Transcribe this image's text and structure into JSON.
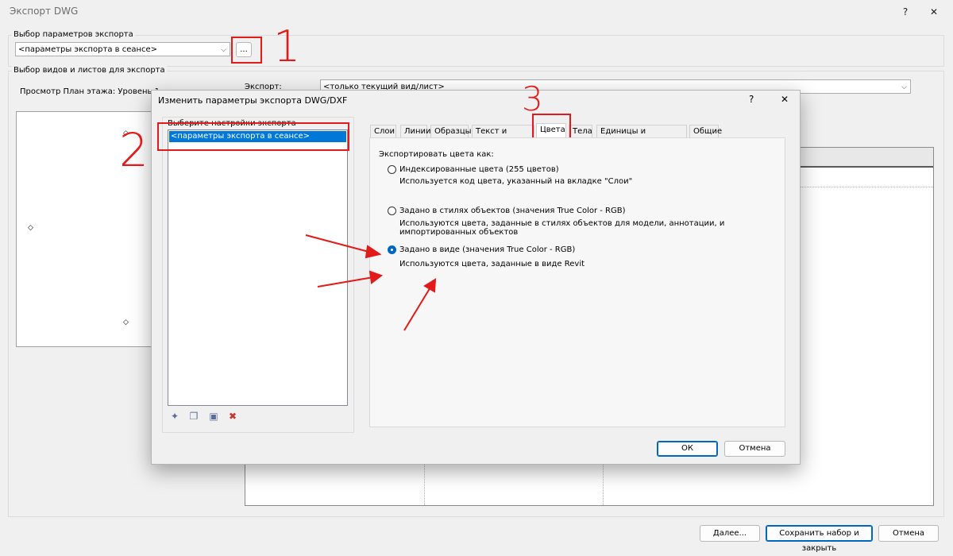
{
  "window": {
    "title": "Экспорт DWG",
    "help": "?",
    "close": "✕"
  },
  "export_params": {
    "group_label": "Выбор параметров экспорта",
    "combo_value": "<параметры экспорта в сеансе>",
    "browse_label": "..."
  },
  "views": {
    "group_label": "Выбор видов и листов для экспорта",
    "preview_label": "Просмотр План этажа: Уровень 1",
    "export_label": "Экспорт:",
    "export_value": "<только текущий вид/лист>"
  },
  "annotations": {
    "n1": "1",
    "n2": "2",
    "n3": "3",
    "color": "#e21a1a"
  },
  "dialog": {
    "title": "Изменить параметры экспорта DWG/DXF",
    "help": "?",
    "close": "✕",
    "setup_label": "Выберите настройки экспорта",
    "setup_items": [
      "<параметры экспорта в сеансе>"
    ],
    "tabs": [
      "Слои",
      "Линии",
      "Образцы",
      "Текст и шрифты",
      "Цвета",
      "Тела",
      "Единицы и координаты",
      "Общие"
    ],
    "active_tab": "Цвета",
    "export_colors_label": "Экспортировать цвета как:",
    "options": [
      {
        "label": "Индексированные цвета (255 цветов)",
        "desc": "Используется код цвета, указанный на вкладке \"Слои\"",
        "selected": false
      },
      {
        "label": "Задано в стилях объектов (значения True Color - RGB)",
        "desc": "Используются цвета, заданные в стилях объектов для модели, аннотации, и импортированных объектов",
        "selected": false
      },
      {
        "label": "Задано в виде (значения True Color - RGB)",
        "desc": "Используются цвета, заданные в виде Revit",
        "selected": true
      }
    ],
    "ok_label": "ОК",
    "cancel_label": "Отмена"
  },
  "footer": {
    "next_label": "Далее...",
    "save_close_label": "Сохранить набор и закрыть",
    "cancel_label": "Отмена"
  }
}
